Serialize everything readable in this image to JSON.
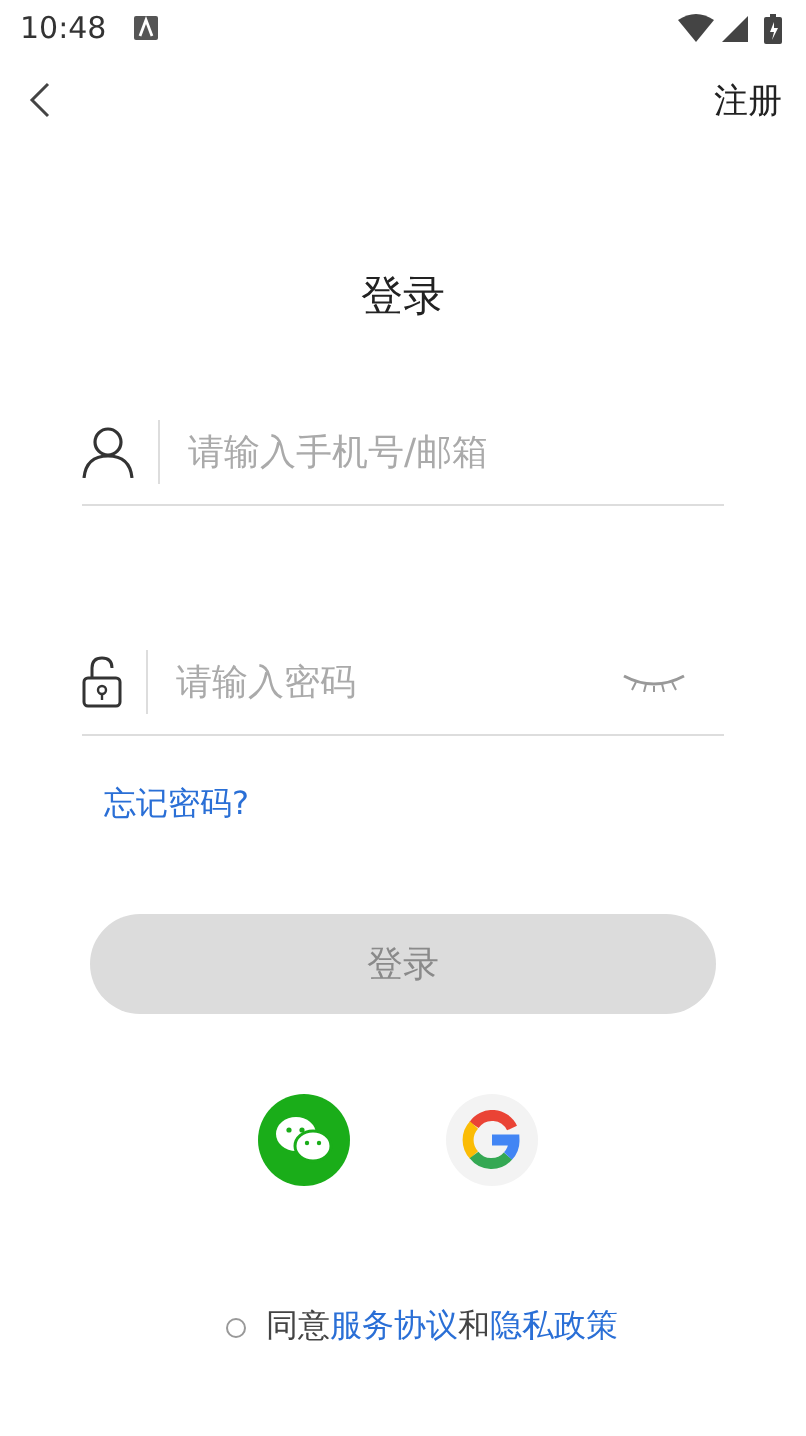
{
  "status_bar": {
    "time": "10:48"
  },
  "header": {
    "action": "注册"
  },
  "title": "登录",
  "account_field": {
    "placeholder": "请输入手机号/邮箱"
  },
  "password_field": {
    "placeholder": "请输入密码",
    "visible": false
  },
  "forgot_link": "忘记密码?",
  "login_button": {
    "label": "登录",
    "disabled": true
  },
  "agreement": {
    "checked": false,
    "prefix": "同意",
    "link_1": "服务协议",
    "joiner": "和",
    "link_2": "隐私政策"
  }
}
